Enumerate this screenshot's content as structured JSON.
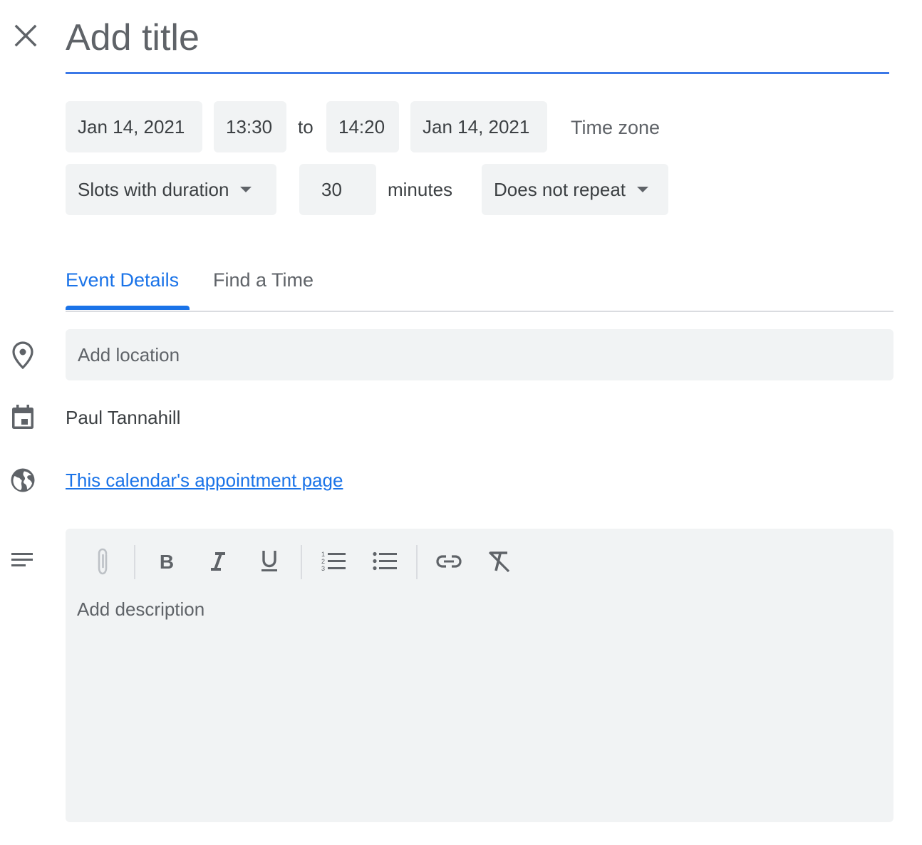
{
  "header": {
    "close_icon": "close-icon",
    "title_placeholder": "Add title"
  },
  "datetime": {
    "start_date": "Jan 14, 2021",
    "start_time": "13:30",
    "to_label": "to",
    "end_time": "14:20",
    "end_date": "Jan 14, 2021",
    "time_zone_label": "Time zone"
  },
  "slots": {
    "mode_label": "Slots with duration",
    "duration_value": "30",
    "duration_unit": "minutes",
    "repeat_label": "Does not repeat"
  },
  "tabs": [
    {
      "label": "Event Details",
      "active": true
    },
    {
      "label": "Find a Time",
      "active": false
    }
  ],
  "details": {
    "location_placeholder": "Add location",
    "calendar_owner": "Paul Tannahill",
    "appointment_link": "This calendar's appointment page",
    "description_placeholder": "Add description"
  },
  "toolbar_icons": [
    "attachment-icon",
    "bold-icon",
    "italic-icon",
    "underline-icon",
    "numbered-list-icon",
    "bulleted-list-icon",
    "link-icon",
    "remove-formatting-icon"
  ],
  "colors": {
    "accent": "#1a73e8",
    "underline": "#3b78e7",
    "chip_background": "#f1f3f4",
    "text": "#3c4043",
    "muted": "#5f6368"
  }
}
